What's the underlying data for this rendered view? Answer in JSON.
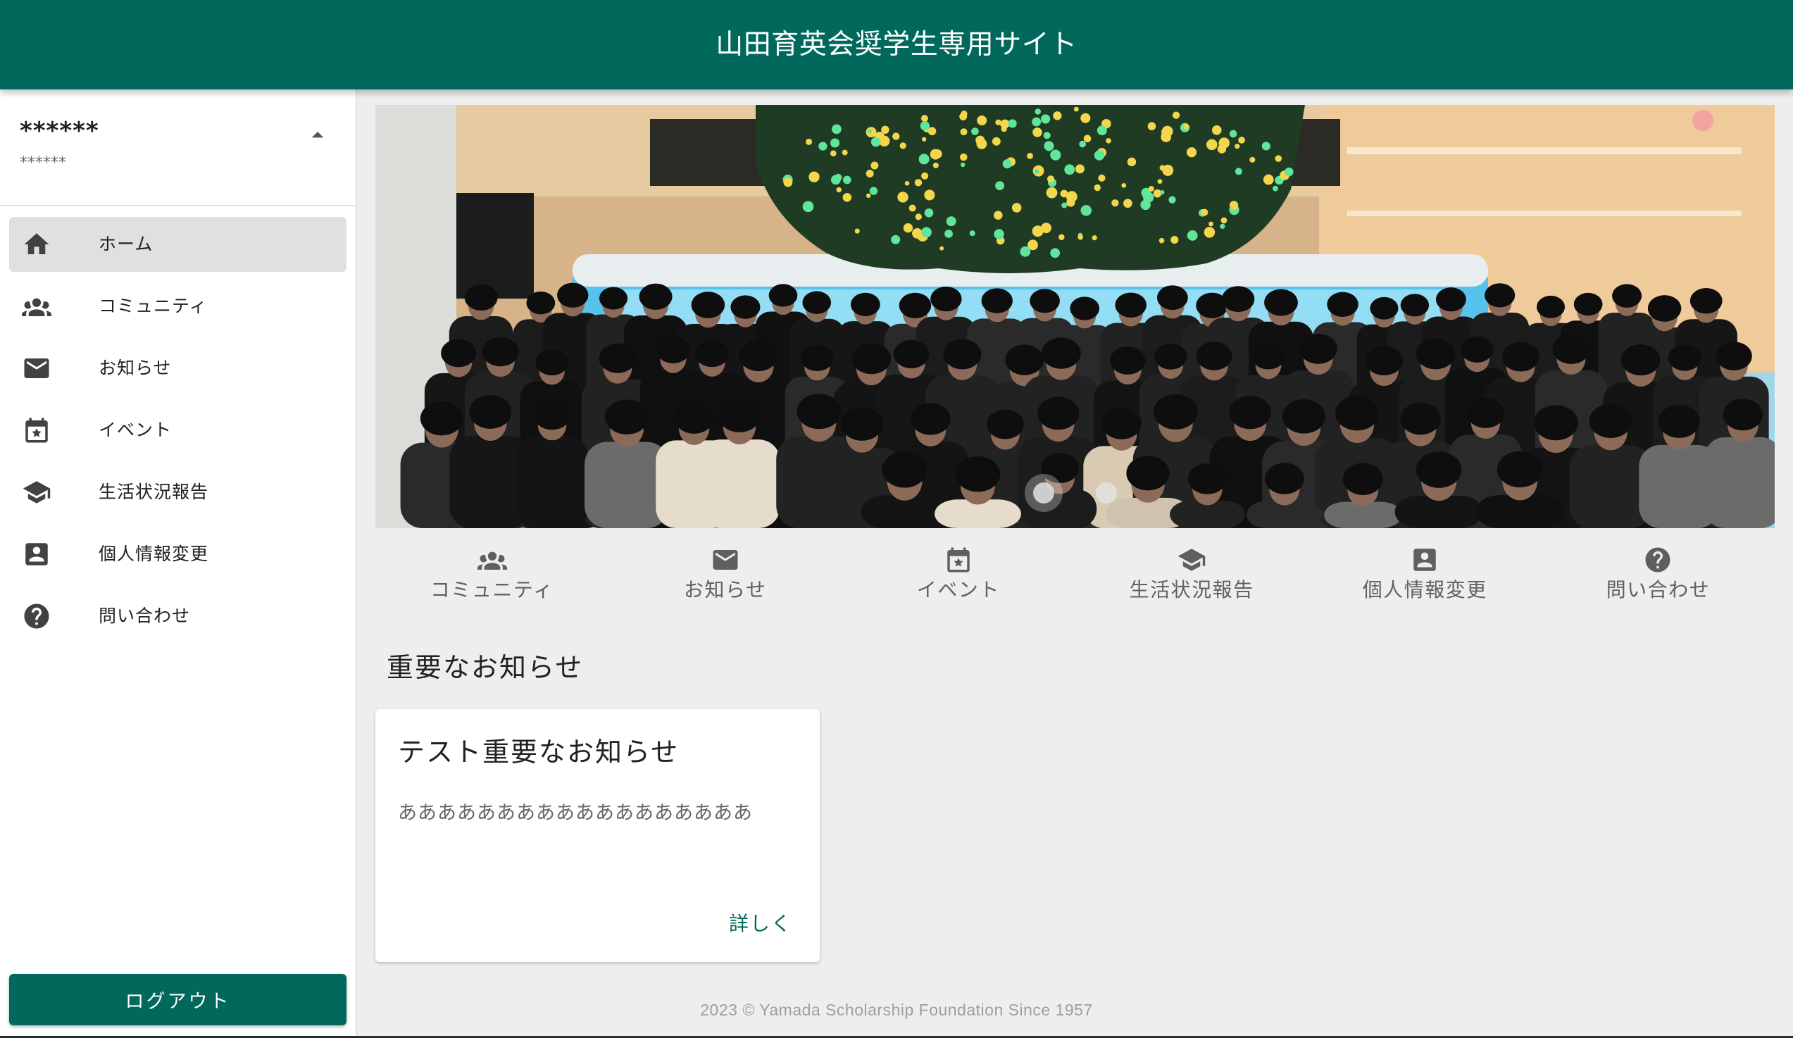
{
  "theme": {
    "primary": "#00695c",
    "page_background": "#eeeeee",
    "sidebar_background": "#ffffff",
    "active_item_background": "#e0e0e0",
    "footer_text": "#9e9e9e"
  },
  "header": {
    "title": "山田育英会奨学生専用サイト"
  },
  "user": {
    "name": "******",
    "sub": "******",
    "menu_icon": "arrow-drop-up-icon"
  },
  "sidebar": {
    "items": [
      {
        "label": "ホーム",
        "icon": "home-icon",
        "active": true
      },
      {
        "label": "コミュニティ",
        "icon": "account-group-icon",
        "active": false
      },
      {
        "label": "お知らせ",
        "icon": "email-icon",
        "active": false
      },
      {
        "label": "イベント",
        "icon": "calendar-star-icon",
        "active": false
      },
      {
        "label": "生活状況報告",
        "icon": "school-icon",
        "active": false
      },
      {
        "label": "個人情報変更",
        "icon": "account-box-icon",
        "active": false
      },
      {
        "label": "問い合わせ",
        "icon": "help-circle-icon",
        "active": false
      }
    ],
    "logout_label": "ログアウト"
  },
  "carousel": {
    "slide_count": 2,
    "active_index": 0
  },
  "quick_links": [
    {
      "label": "コミュニティ",
      "icon": "account-group-icon"
    },
    {
      "label": "お知らせ",
      "icon": "email-icon"
    },
    {
      "label": "イベント",
      "icon": "calendar-star-icon"
    },
    {
      "label": "生活状況報告",
      "icon": "school-icon"
    },
    {
      "label": "個人情報変更",
      "icon": "account-box-icon"
    },
    {
      "label": "問い合わせ",
      "icon": "help-circle-icon"
    }
  ],
  "important_notices": {
    "heading": "重要なお知らせ",
    "cards": [
      {
        "title": "テスト重要なお知らせ",
        "body": "ああああああああああああああああああ",
        "link_label": "詳しく"
      }
    ]
  },
  "footer": {
    "text": "2023 © Yamada Scholarship Foundation Since 1957"
  }
}
